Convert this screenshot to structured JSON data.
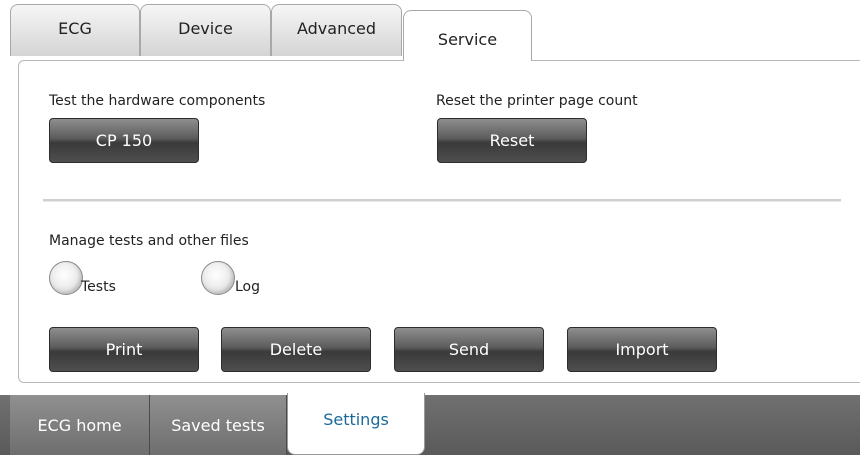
{
  "top_tabs": [
    {
      "label": "ECG",
      "active": false
    },
    {
      "label": "Device",
      "active": false
    },
    {
      "label": "Advanced",
      "active": false
    },
    {
      "label": "Service",
      "active": true
    }
  ],
  "hardware": {
    "label": "Test the hardware components",
    "button": "CP 150"
  },
  "printer": {
    "label": "Reset the printer page count",
    "button": "Reset"
  },
  "files": {
    "label": "Manage tests and other files",
    "radio_tests": "Tests",
    "radio_log": "Log",
    "buttons": {
      "print": "Print",
      "delete": "Delete",
      "send": "Send",
      "import": "Import"
    }
  },
  "bottom_tabs": [
    {
      "label": "ECG home",
      "active": false
    },
    {
      "label": "Saved tests",
      "active": false
    },
    {
      "label": "Settings",
      "active": true
    }
  ],
  "colors": {
    "button_dark": "#4a4a4a",
    "active_bottom_text": "#1a6a9a",
    "bottom_bar": "#606060"
  }
}
